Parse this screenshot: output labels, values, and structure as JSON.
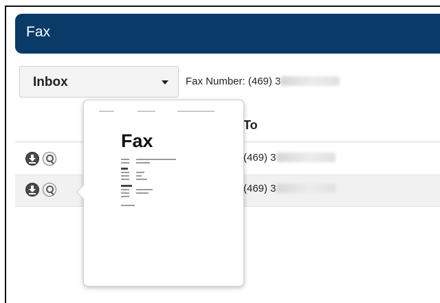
{
  "header": {
    "title": "Fax"
  },
  "toolbar": {
    "folder_select": {
      "selected": "Inbox"
    },
    "fax_number_label": "Fax Number: (469) 3"
  },
  "table": {
    "columns": [
      "To"
    ],
    "rows": [
      {
        "to": "(469) 3"
      },
      {
        "to": "(469) 3"
      }
    ]
  },
  "preview": {
    "heading": "Fax"
  }
}
